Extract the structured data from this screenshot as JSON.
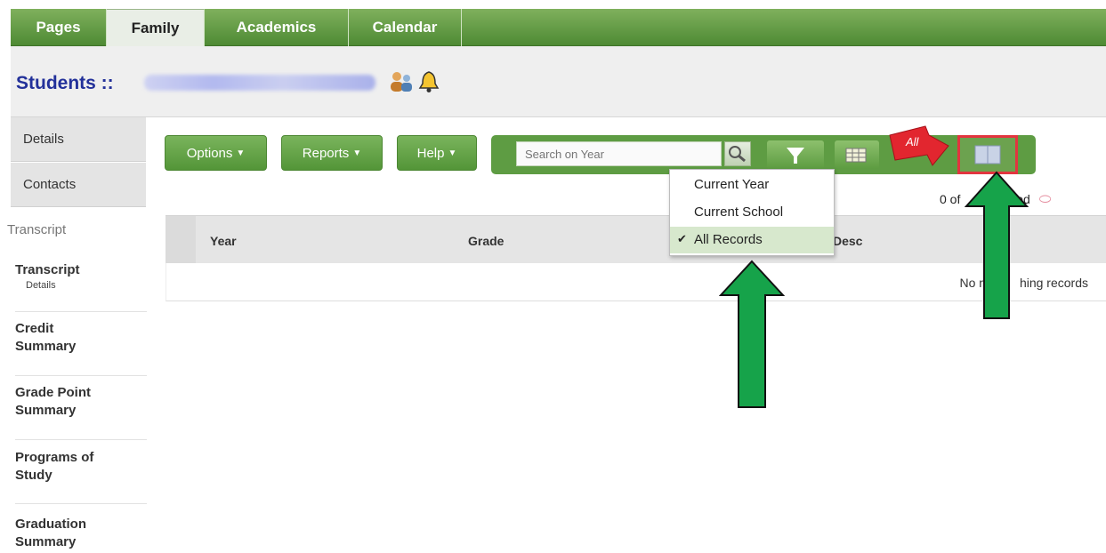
{
  "nav": {
    "tabs": [
      "Pages",
      "Family",
      "Academics",
      "Calendar"
    ],
    "active": "Family"
  },
  "header": {
    "title": "Students ::"
  },
  "sidebar": {
    "tabs": [
      "Details",
      "Contacts"
    ],
    "section": "Transcript",
    "items": [
      {
        "label": "Transcript",
        "sub": "Details"
      },
      {
        "label": "Credit Summary"
      },
      {
        "label": "Grade Point Summary"
      },
      {
        "label": "Programs of Study"
      },
      {
        "label": "Graduation Summary"
      }
    ]
  },
  "toolbar": {
    "options_label": "Options",
    "reports_label": "Reports",
    "help_label": "Help",
    "search_placeholder": "Search on Year"
  },
  "filter_menu": {
    "options": [
      "Current Year",
      "Current School",
      "All Records"
    ],
    "selected": "All Records"
  },
  "callout": {
    "label": "All"
  },
  "table": {
    "columns": [
      "Year",
      "Grade",
      "Desc"
    ],
    "selected_count_prefix": "0 of",
    "selected_count_suffix": "cted",
    "empty_message_prefix": "No m",
    "empty_message_suffix": "hing records"
  },
  "colors": {
    "nav_green": "#5e9c43",
    "title_blue": "#23319a",
    "annotation_green": "#16a34a",
    "annotation_red": "#e2353f"
  }
}
